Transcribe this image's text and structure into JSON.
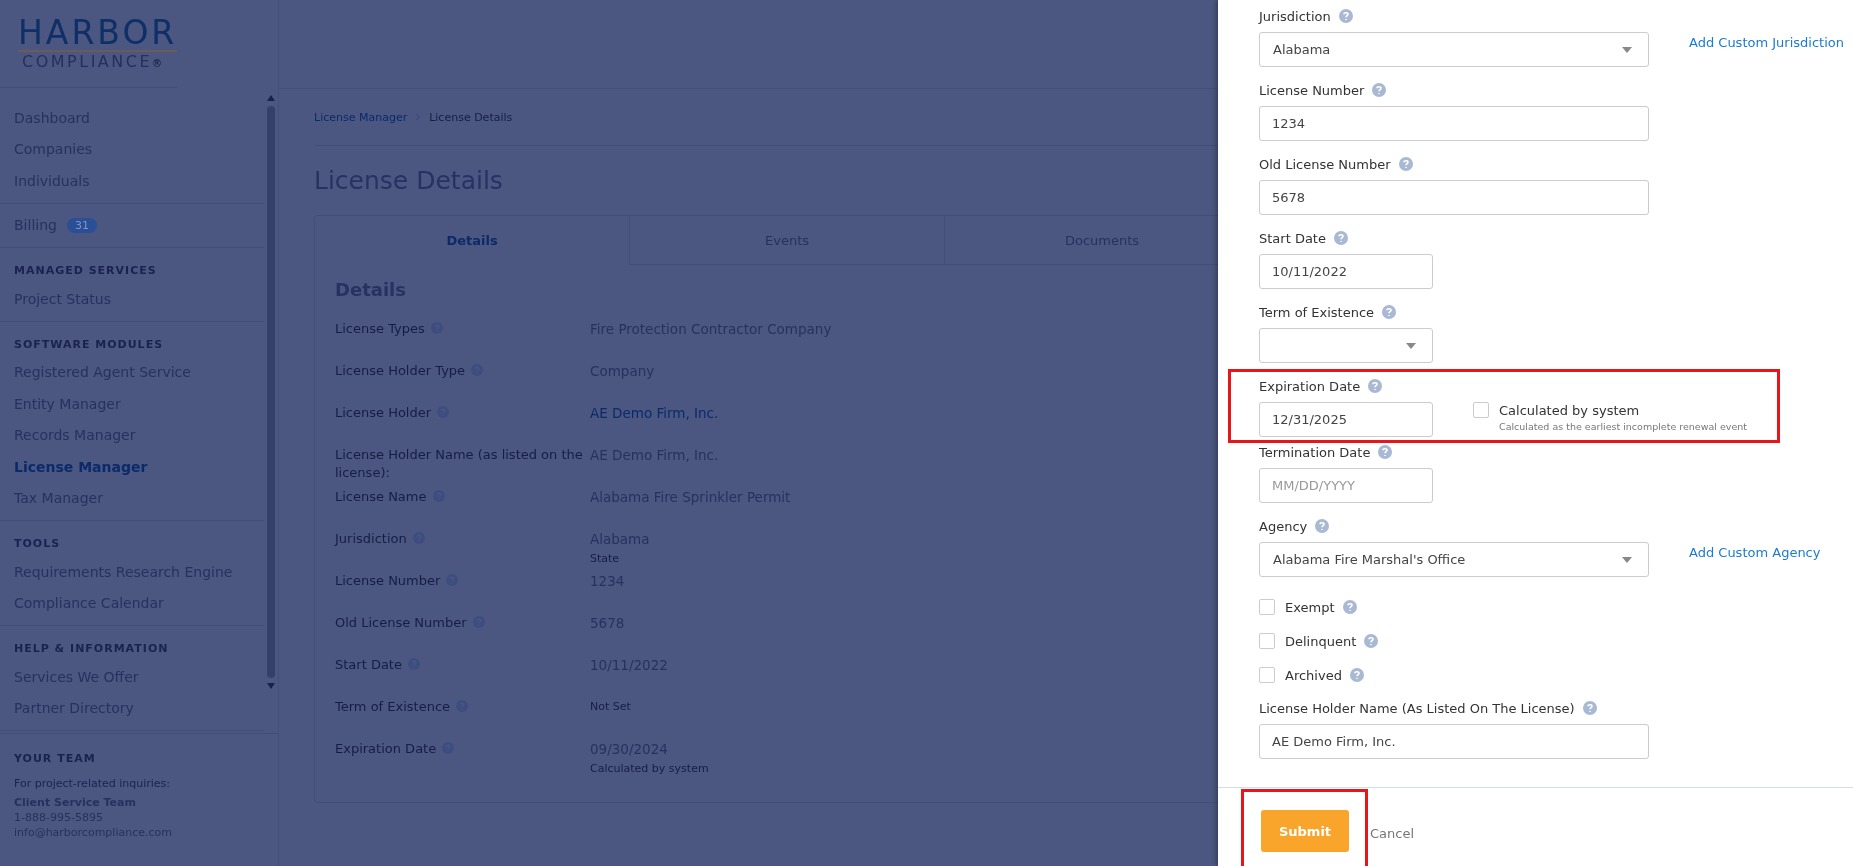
{
  "logo": {
    "line_1": "HARBOR",
    "line_2": "COMPLIANCE",
    "mark": "®"
  },
  "sidebar": {
    "groups": [
      {
        "items": [
          {
            "label": "Dashboard",
            "selected": false
          },
          {
            "label": "Companies",
            "selected": false
          },
          {
            "label": "Individuals",
            "selected": false
          }
        ]
      },
      {
        "items": [
          {
            "label": "Billing",
            "badge": "31",
            "selected": false
          }
        ]
      },
      {
        "heading": "MANAGED SERVICES",
        "items": [
          {
            "label": "Project Status",
            "selected": false
          }
        ]
      },
      {
        "heading": "SOFTWARE MODULES",
        "items": [
          {
            "label": "Registered Agent Service",
            "selected": false
          },
          {
            "label": "Entity Manager",
            "selected": false
          },
          {
            "label": "Records Manager",
            "selected": false
          },
          {
            "label": "License Manager",
            "selected": true
          },
          {
            "label": "Tax Manager",
            "selected": false
          }
        ]
      },
      {
        "heading": "TOOLS",
        "items": [
          {
            "label": "Requirements Research Engine",
            "selected": false
          },
          {
            "label": "Compliance Calendar",
            "selected": false
          }
        ]
      },
      {
        "heading": "HELP & INFORMATION",
        "items": [
          {
            "label": "Services We Offer",
            "selected": false
          },
          {
            "label": "Partner Directory",
            "selected": false
          }
        ]
      }
    ],
    "team": {
      "heading": "YOUR TEAM",
      "intro": "For project-related inquiries:",
      "name": "Client Service Team",
      "phone": "1-888-995-5895",
      "email": "info@harborcompliance.com"
    }
  },
  "breadcrumb": [
    {
      "label": "License Manager",
      "kind": "link"
    },
    {
      "label": "License Details",
      "kind": "current"
    }
  ],
  "page_title": "License Details",
  "tabs": [
    {
      "label": "Details",
      "selected": true
    },
    {
      "label": "Events",
      "selected": false
    },
    {
      "label": "Documents",
      "selected": false
    }
  ],
  "details": {
    "title": "Details",
    "rows": [
      {
        "label": "License Types",
        "help": true,
        "value": "Fire Protection Contractor Company",
        "kind": "plain"
      },
      {
        "label": "License Holder Type",
        "help": true,
        "value": "Company",
        "kind": "plain"
      },
      {
        "label": "License Holder",
        "help": true,
        "value": "AE Demo Firm, Inc.",
        "kind": "link"
      },
      {
        "label": "License Holder Name (as listed on the license):",
        "help": false,
        "value": "AE Demo Firm, Inc.",
        "kind": "plain"
      },
      {
        "label": "License Name",
        "help": true,
        "value": "Alabama Fire Sprinkler Permit",
        "kind": "plain"
      },
      {
        "label": "Jurisdiction",
        "help": true,
        "value": "Alabama",
        "sub": "State",
        "kind": "plain"
      },
      {
        "label": "License Number",
        "help": true,
        "value": "1234",
        "kind": "plain"
      },
      {
        "label": "Old License Number",
        "help": true,
        "value": "5678",
        "kind": "plain"
      },
      {
        "label": "Start Date",
        "help": true,
        "value": "10/11/2022",
        "kind": "plain"
      },
      {
        "label": "Term of Existence",
        "help": true,
        "value": "Not Set",
        "kind": "muted"
      },
      {
        "label": "Expiration Date",
        "help": true,
        "value": "09/30/2024",
        "sub": "Calculated by system",
        "kind": "plain"
      }
    ]
  },
  "panel": {
    "fields": [
      {
        "kind": "select",
        "label": "Jurisdiction",
        "value": "Alabama",
        "link": "Add Custom Jurisdiction"
      },
      {
        "kind": "text",
        "label": "License Number",
        "value": "1234"
      },
      {
        "kind": "text",
        "label": "Old License Number",
        "value": "5678"
      },
      {
        "kind": "date",
        "label": "Start Date",
        "value": "10/11/2022"
      },
      {
        "kind": "short-select",
        "label": "Term of Existence"
      },
      {
        "kind": "date",
        "label": "Expiration Date",
        "value": "12/31/2025",
        "highlighted": true,
        "option": {
          "label": "Calculated by system",
          "checked": false,
          "note": "Calculated as the earliest incomplete renewal event"
        }
      },
      {
        "kind": "date",
        "label": "Termination Date",
        "placeholder": "MM/DD/YYYY"
      },
      {
        "kind": "select",
        "label": "Agency",
        "value": "Alabama Fire Marshal's Office",
        "link": "Add Custom Agency"
      },
      {
        "kind": "checkbox",
        "label": "Exempt",
        "checked": false
      },
      {
        "kind": "checkbox",
        "label": "Delinquent",
        "checked": false
      },
      {
        "kind": "checkbox",
        "label": "Archived",
        "checked": false
      },
      {
        "kind": "text",
        "label": "License Holder Name (As Listed On The License)",
        "value": "AE Demo Firm, Inc."
      }
    ],
    "submit": {
      "label": "Submit",
      "highlighted": true
    },
    "cancel": "Cancel"
  }
}
